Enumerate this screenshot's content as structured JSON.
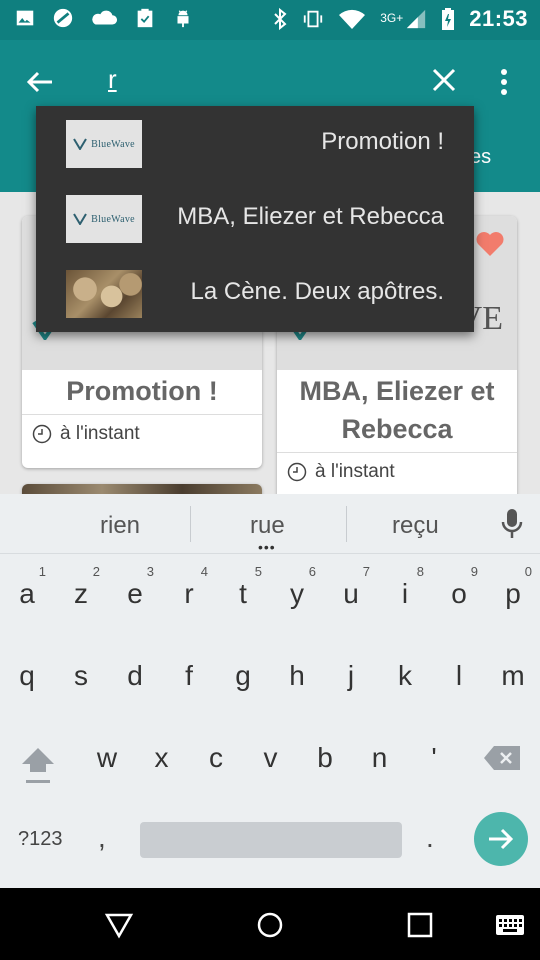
{
  "status_bar": {
    "time": "21:53",
    "network": "3G+",
    "left_icons": [
      "image-icon",
      "no-entry-icon",
      "cloud-icon",
      "clipboard-check-icon",
      "android-icon"
    ],
    "right_icons": [
      "bluetooth-icon",
      "vibrate-icon",
      "wifi-icon",
      "signal-icon",
      "battery-icon"
    ]
  },
  "toolbar": {
    "search_query": "r",
    "tab_partial": "ces",
    "color": "#138a8a"
  },
  "suggestions": [
    {
      "label": "Promotion !",
      "thumb": "bluewave-logo"
    },
    {
      "label": "MBA, Eliezer et Rebecca",
      "thumb": "bluewave-logo"
    },
    {
      "label": "La Cène. Deux apôtres.",
      "thumb": "fresco-image"
    }
  ],
  "logo_text": "BlueWave",
  "cards": [
    {
      "title": "Promotion !",
      "time": "à l'instant"
    },
    {
      "title": "MBA, Eliezer et Rebecca",
      "time": "à l'instant",
      "logo_fragment": "VE"
    }
  ],
  "keyboard": {
    "suggestions": [
      "rien",
      "rue",
      "reçu"
    ],
    "row1": [
      {
        "k": "a",
        "n": "1"
      },
      {
        "k": "z",
        "n": "2"
      },
      {
        "k": "e",
        "n": "3"
      },
      {
        "k": "r",
        "n": "4"
      },
      {
        "k": "t",
        "n": "5"
      },
      {
        "k": "y",
        "n": "6"
      },
      {
        "k": "u",
        "n": "7"
      },
      {
        "k": "i",
        "n": "8"
      },
      {
        "k": "o",
        "n": "9"
      },
      {
        "k": "p",
        "n": "0"
      }
    ],
    "row2": [
      "q",
      "s",
      "d",
      "f",
      "g",
      "h",
      "j",
      "k",
      "l",
      "m"
    ],
    "row3": [
      "w",
      "x",
      "c",
      "v",
      "b",
      "n",
      "'"
    ],
    "symbols_label": "?123",
    "comma": ",",
    "period": ".",
    "accent_color": "#4db6ac"
  }
}
